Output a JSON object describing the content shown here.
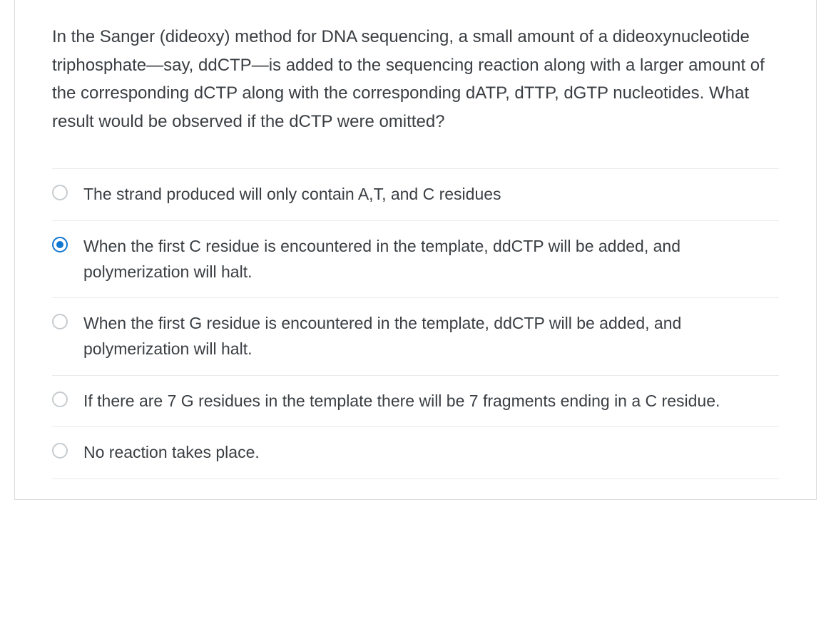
{
  "question": {
    "text": "In the Sanger (dideoxy) method for DNA sequencing, a small amount of a dideoxynucleotide triphosphate—say, ddCTP—is added to the sequencing reaction along with a larger amount of the corresponding dCTP along with the corresponding dATP, dTTP, dGTP nucleotides.  What result would be observed if the dCTP were omitted?"
  },
  "options": [
    {
      "text": "The strand produced will only contain A,T, and C residues",
      "selected": false
    },
    {
      "text": "When the first C residue is encountered in the template, ddCTP will be added, and polymerization will halt.",
      "selected": true
    },
    {
      "text": "When the first G residue is encountered in the template, ddCTP will be added, and polymerization will halt.",
      "selected": false
    },
    {
      "text": "If there are 7 G residues in the template there will be 7 fragments ending in a C residue.",
      "selected": false
    },
    {
      "text": "No reaction takes place.",
      "selected": false
    }
  ]
}
